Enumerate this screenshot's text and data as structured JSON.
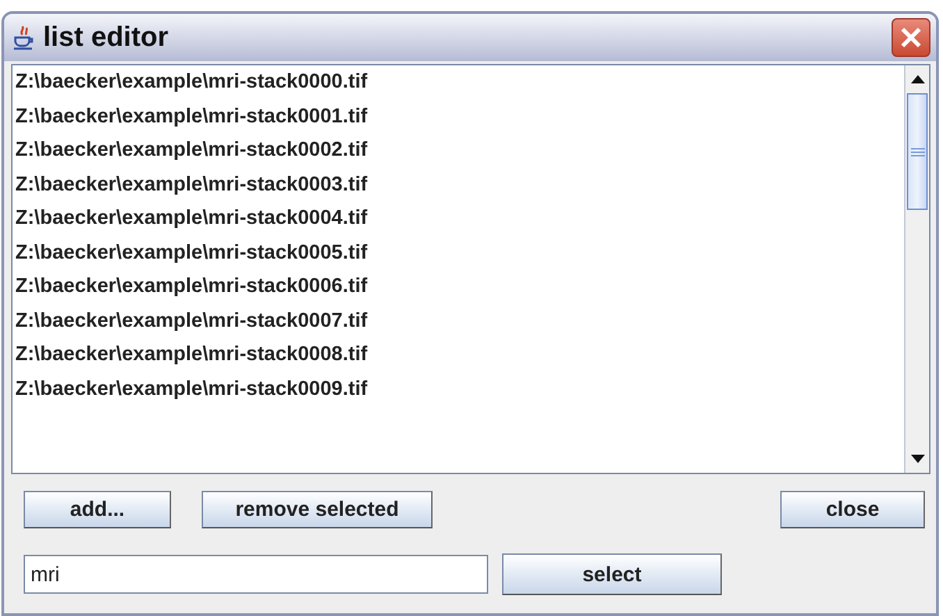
{
  "window": {
    "title": "list editor"
  },
  "list": {
    "items": [
      "Z:\\baecker\\example\\mri-stack0000.tif",
      "Z:\\baecker\\example\\mri-stack0001.tif",
      "Z:\\baecker\\example\\mri-stack0002.tif",
      "Z:\\baecker\\example\\mri-stack0003.tif",
      "Z:\\baecker\\example\\mri-stack0004.tif",
      "Z:\\baecker\\example\\mri-stack0005.tif",
      "Z:\\baecker\\example\\mri-stack0006.tif",
      "Z:\\baecker\\example\\mri-stack0007.tif",
      "Z:\\baecker\\example\\mri-stack0008.tif",
      "Z:\\baecker\\example\\mri-stack0009.tif"
    ]
  },
  "buttons": [
    "add...",
    "remove selected",
    "close"
  ],
  "filter": {
    "value": "mri",
    "button": "select"
  }
}
